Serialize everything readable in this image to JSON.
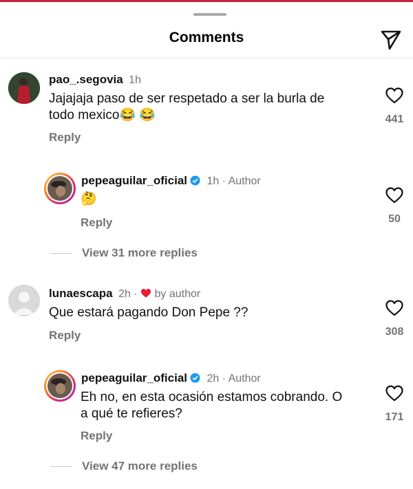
{
  "header": {
    "title": "Comments",
    "share_icon": "paper-plane-icon"
  },
  "comments": [
    {
      "username": "pao_.segovia",
      "time": "1h",
      "text_line1": "Jajajaja paso de ser respetado a ser la burla de",
      "text_line2": "todo mexico😂 😂",
      "reply_label": "Reply",
      "likes": "441"
    },
    {
      "username": "pepeaguilar_oficial",
      "time": "1h",
      "author_label": "Author",
      "text_line1": "🤔",
      "reply_label": "Reply",
      "likes": "50"
    },
    {
      "username": "lunaescapa",
      "time": "2h",
      "liked_by": "by author",
      "text_line1": "Que estará pagando Don Pepe ??",
      "reply_label": "Reply",
      "likes": "308"
    },
    {
      "username": "pepeaguilar_oficial",
      "time": "2h",
      "author_label": "Author",
      "text_line1": "Eh no, en esta ocasión estamos cobrando. O",
      "text_line2": "a qué te refieres?",
      "reply_label": "Reply",
      "likes": "171"
    }
  ],
  "view_more": [
    {
      "label": "View 31 more replies"
    },
    {
      "label": "View 47 more replies"
    }
  ],
  "colors": {
    "text": "#111111",
    "muted": "#737373",
    "heart_red": "#ed1c3a",
    "verified_blue": "#1d9bf0"
  }
}
